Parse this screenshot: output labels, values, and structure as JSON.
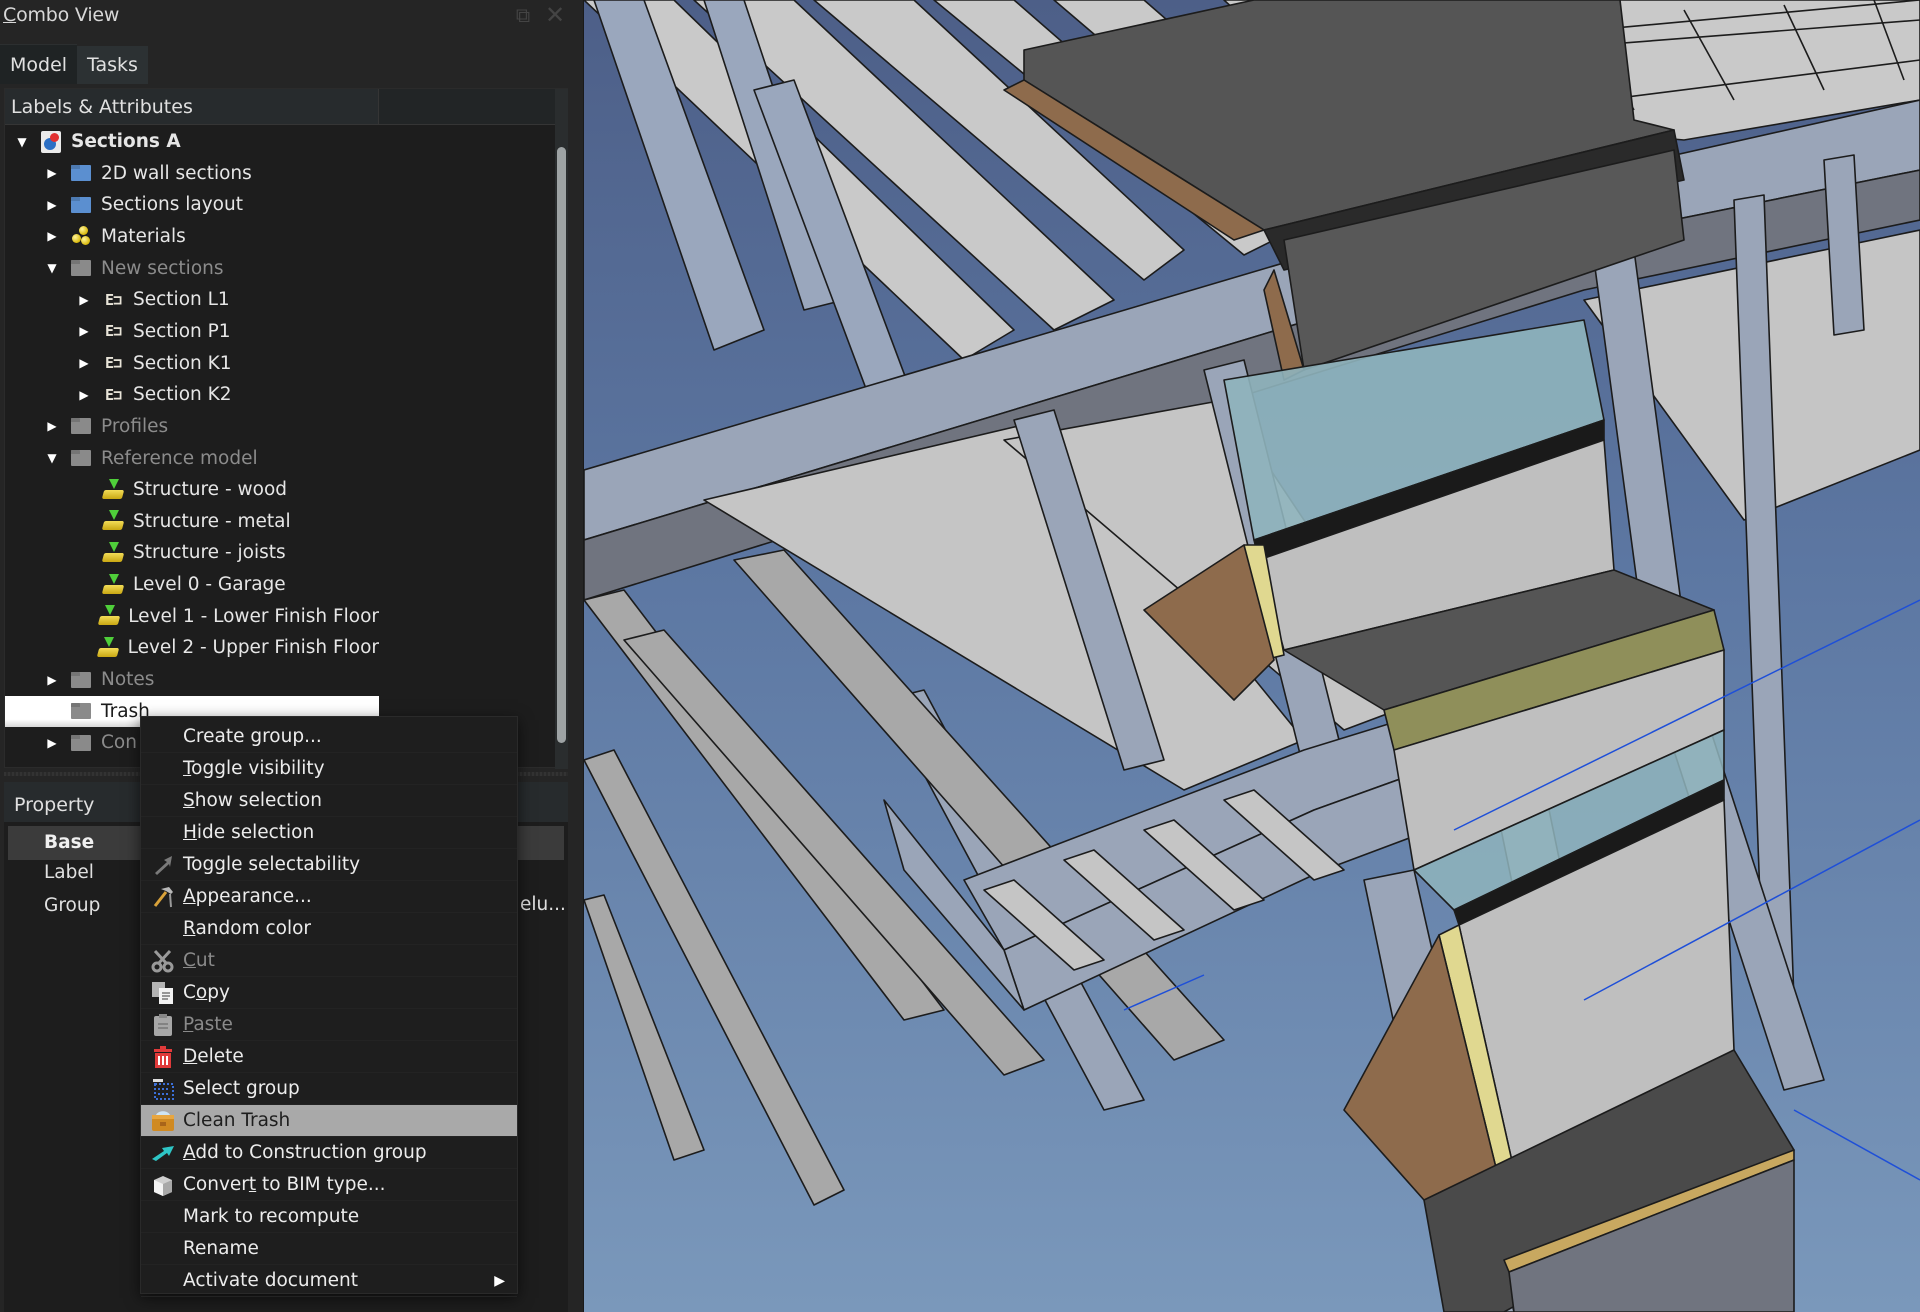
{
  "combo_view": {
    "title": "Combo View",
    "tabs": [
      {
        "label": "Model",
        "active": true
      },
      {
        "label": "Tasks",
        "active": false
      }
    ],
    "tree_header": "Labels & Attributes",
    "tree": [
      {
        "label": "Sections A",
        "icon": "document-icon",
        "level": 0,
        "expanded": true,
        "bold": true
      },
      {
        "label": "2D wall sections",
        "icon": "folder-blue-icon",
        "level": 1,
        "expanded": false
      },
      {
        "label": "Sections layout",
        "icon": "folder-blue-icon",
        "level": 1,
        "expanded": false
      },
      {
        "label": "Materials",
        "icon": "materials-icon",
        "level": 1,
        "expanded": false
      },
      {
        "label": "New sections",
        "icon": "folder-gray-icon",
        "level": 1,
        "expanded": true,
        "dim": true
      },
      {
        "label": "Section L1",
        "icon": "section-plane-icon",
        "level": 2,
        "expanded": false
      },
      {
        "label": "Section P1",
        "icon": "section-plane-icon",
        "level": 2,
        "expanded": false
      },
      {
        "label": "Section K1",
        "icon": "section-plane-icon",
        "level": 2,
        "expanded": false
      },
      {
        "label": "Section K2",
        "icon": "section-plane-icon",
        "level": 2,
        "expanded": false
      },
      {
        "label": "Profiles",
        "icon": "folder-gray-icon",
        "level": 1,
        "expanded": false,
        "dim": true
      },
      {
        "label": "Reference model",
        "icon": "folder-gray-icon",
        "level": 1,
        "expanded": true,
        "dim": true
      },
      {
        "label": "Structure - wood",
        "icon": "bim-level-icon",
        "level": 2
      },
      {
        "label": "Structure - metal",
        "icon": "bim-level-icon",
        "level": 2
      },
      {
        "label": "Structure - joists",
        "icon": "bim-level-icon",
        "level": 2
      },
      {
        "label": "Level 0 - Garage",
        "icon": "bim-level-icon",
        "level": 2
      },
      {
        "label": "Level 1 - Lower Finish Floor",
        "icon": "bim-level-icon",
        "level": 2
      },
      {
        "label": "Level 2 - Upper Finish Floor",
        "icon": "bim-level-icon",
        "level": 2
      },
      {
        "label": "Notes",
        "icon": "folder-gray-icon",
        "level": 1,
        "expanded": false,
        "dim": true
      },
      {
        "label": "Trash",
        "icon": "folder-gray-icon",
        "level": 1,
        "selected": true
      },
      {
        "label": "Con",
        "icon": "folder-gray-icon",
        "level": 1,
        "expanded": false,
        "dim": true
      }
    ],
    "property_panel": {
      "header": "Property",
      "group": "Base",
      "rows": [
        {
          "name": "Label"
        },
        {
          "name": "Group"
        }
      ],
      "visible_value_fragment": "elu..."
    }
  },
  "context_menu": {
    "items": [
      {
        "label": "Create group...",
        "icon": null,
        "mnemonic": ""
      },
      {
        "label": "Toggle visibility",
        "icon": null,
        "mnemonic": "T"
      },
      {
        "label": "Show selection",
        "icon": null,
        "mnemonic": "S"
      },
      {
        "label": "Hide selection",
        "icon": null,
        "mnemonic": "H"
      },
      {
        "label": "Toggle selectability",
        "icon": "selectability-arrow-icon",
        "mnemonic": ""
      },
      {
        "label": "Appearance...",
        "icon": "hammer-icon",
        "mnemonic": "A"
      },
      {
        "label": "Random color",
        "icon": null,
        "mnemonic": "R"
      },
      {
        "label": "Cut",
        "icon": "scissors-icon",
        "mnemonic": "C",
        "disabled": true
      },
      {
        "label": "Copy",
        "icon": "copy-icon",
        "mnemonic": "o"
      },
      {
        "label": "Paste",
        "icon": "paste-icon",
        "mnemonic": "P",
        "disabled": true
      },
      {
        "label": "Delete",
        "icon": "trash-can-icon",
        "mnemonic": "D"
      },
      {
        "label": "Select group",
        "icon": "select-group-icon",
        "mnemonic": ""
      },
      {
        "label": "Clean Trash",
        "icon": "clean-trash-icon",
        "mnemonic": "",
        "hovered": true
      },
      {
        "label": "Add to Construction group",
        "icon": "construction-arrow-icon",
        "mnemonic": "A"
      },
      {
        "label": "Convert to BIM type...",
        "icon": "cube-icon",
        "mnemonic": "t"
      },
      {
        "label": "Mark to recompute",
        "icon": null,
        "mnemonic": ""
      },
      {
        "label": "Rename",
        "icon": null,
        "mnemonic": ""
      },
      {
        "label": "Activate document",
        "icon": null,
        "mnemonic": "",
        "submenu": true
      }
    ]
  },
  "viewport": {
    "description": "3D BIM model view of building structure",
    "colors": {
      "background_top": "#4d5f88",
      "background_bottom": "#7a98bb",
      "beam": "#9aa5b8",
      "joist": "#c8c8c8",
      "slab_dark": "#555555",
      "glass": "#8fb4bc",
      "wood": "#8e6b4c"
    }
  }
}
